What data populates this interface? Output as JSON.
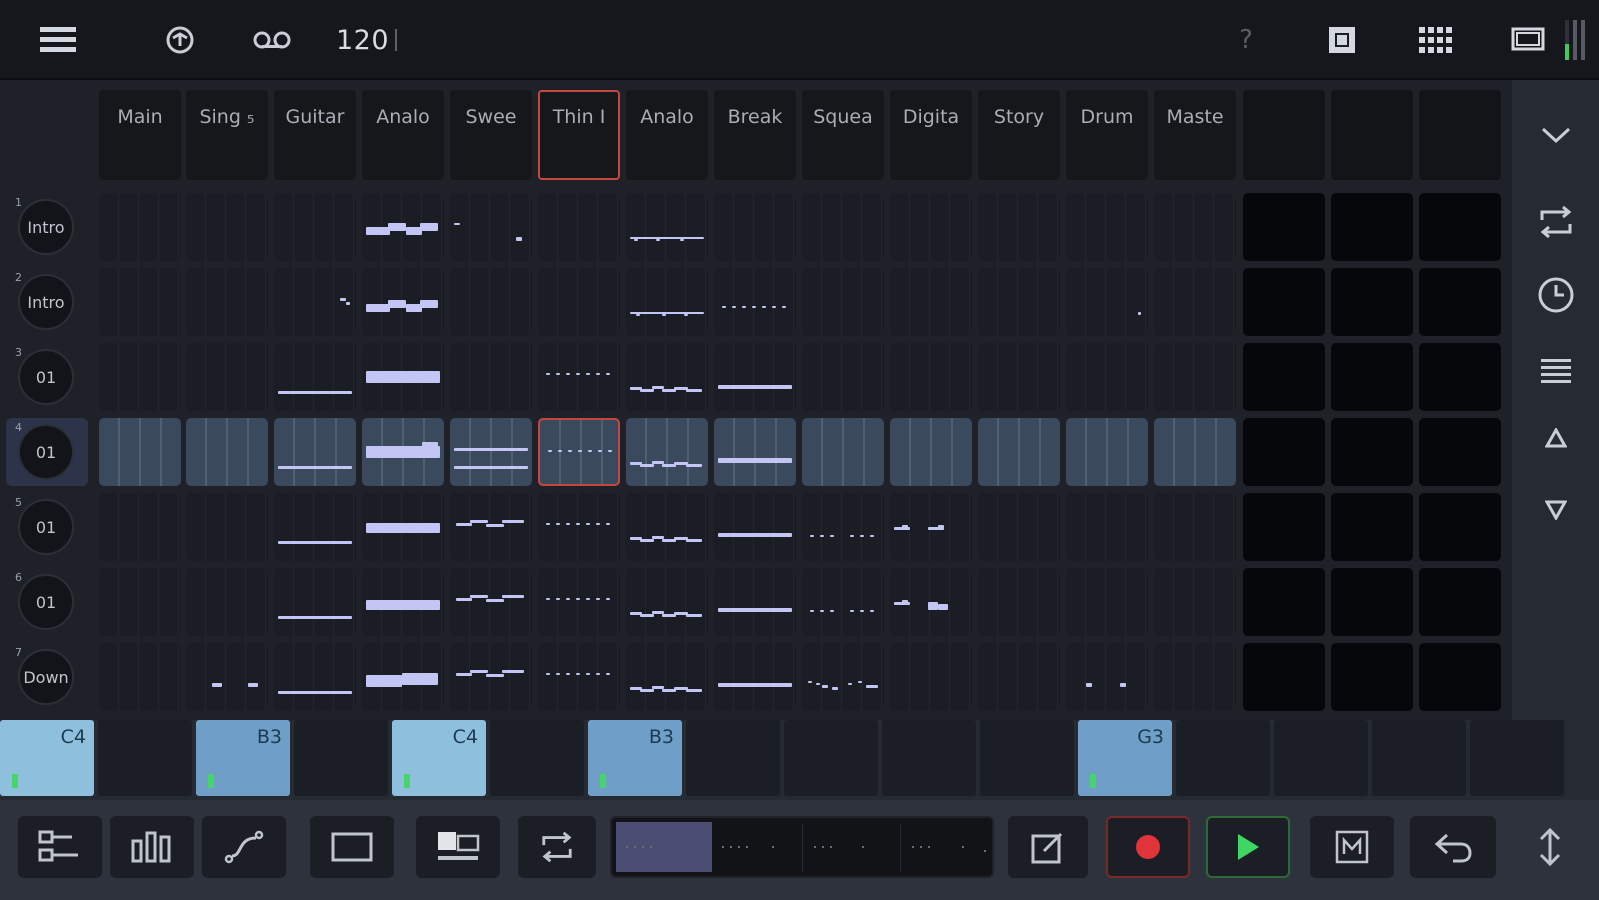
{
  "toolbar": {
    "tempo": "120",
    "help": "?",
    "icons": [
      "menu-icon",
      "metronome-icon",
      "loop-record-icon",
      "help-icon",
      "stop-icon",
      "grid-icon",
      "screen-icon",
      "level-meter-icon"
    ]
  },
  "tracks": [
    {
      "label": "Main"
    },
    {
      "label": "Sing ₅"
    },
    {
      "label": "Guitar"
    },
    {
      "label": "Analo"
    },
    {
      "label": "Swee"
    },
    {
      "label": "Thin I"
    },
    {
      "label": "Analo"
    },
    {
      "label": "Break"
    },
    {
      "label": "Squea"
    },
    {
      "label": "Digita"
    },
    {
      "label": "Story"
    },
    {
      "label": "Drum"
    },
    {
      "label": "Maste"
    }
  ],
  "selected_track": 5,
  "scenes": [
    {
      "num": "1",
      "label": "Intro"
    },
    {
      "num": "2",
      "label": "Intro"
    },
    {
      "num": "3",
      "label": "01"
    },
    {
      "num": "4",
      "label": "01"
    },
    {
      "num": "5",
      "label": "01"
    },
    {
      "num": "6",
      "label": "01"
    },
    {
      "num": "7",
      "label": "Down"
    }
  ],
  "active_scene": 3,
  "pads": [
    {
      "label": "C4",
      "active": true
    },
    {
      "label": "",
      "active": false
    },
    {
      "label": "B3",
      "active": true
    },
    {
      "label": "",
      "active": false
    },
    {
      "label": "C4",
      "active": true
    },
    {
      "label": "",
      "active": false
    },
    {
      "label": "B3",
      "active": true
    },
    {
      "label": "",
      "active": false
    },
    {
      "label": "",
      "active": false
    },
    {
      "label": "",
      "active": false
    },
    {
      "label": "",
      "active": false
    },
    {
      "label": "G3",
      "active": true
    },
    {
      "label": "",
      "active": false
    },
    {
      "label": "",
      "active": false
    },
    {
      "label": "",
      "active": false
    },
    {
      "label": "",
      "active": false
    }
  ],
  "bottom_icons": [
    "mixer-icon",
    "bars-icon",
    "curve-icon",
    "rect-icon",
    "view-icon",
    "loop-icon",
    "edit-icon",
    "record-icon",
    "play-icon",
    "m-icon",
    "undo-icon",
    "expand-icon"
  ],
  "colors": {
    "accent_red": "#c5473d",
    "note_fill": "#c3c6f4",
    "pad_lit": "#8ec0de",
    "play_green": "#3ed764",
    "record_red": "#e0343a"
  }
}
